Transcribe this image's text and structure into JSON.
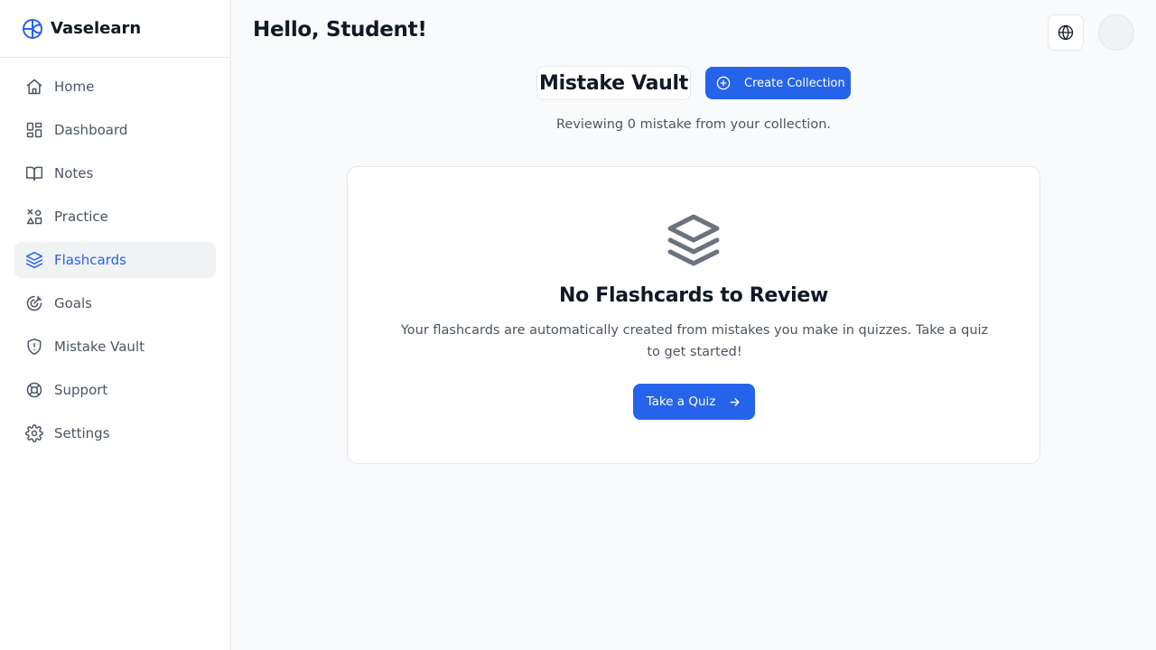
{
  "app": {
    "name": "Vaselearn",
    "logo_icon": "globe-grid-icon"
  },
  "sidebar": {
    "items": [
      {
        "label": "Home",
        "icon": "home-icon",
        "active": false
      },
      {
        "label": "Dashboard",
        "icon": "dashboard-grid-icon",
        "active": false
      },
      {
        "label": "Notes",
        "icon": "book-open-icon",
        "active": false
      },
      {
        "label": "Practice",
        "icon": "shapes-icon",
        "active": false
      },
      {
        "label": "Flashcards",
        "icon": "layers-icon",
        "active": true
      },
      {
        "label": "Goals",
        "icon": "target-icon",
        "active": false
      },
      {
        "label": "Mistake Vault",
        "icon": "shield-alert-icon",
        "active": false
      },
      {
        "label": "Support",
        "icon": "lifebuoy-icon",
        "active": false
      },
      {
        "label": "Settings",
        "icon": "gear-icon",
        "active": false
      }
    ]
  },
  "header": {
    "greeting": "Hello, Student!",
    "language_icon": "globe-icon"
  },
  "main": {
    "title": "Mistake Vault",
    "create_button": "Create Collection",
    "subtitle": "Reviewing 0 mistake from your collection.",
    "empty_state": {
      "icon": "layers-icon",
      "title": "No Flashcards to Review",
      "description": "Your flashcards are automatically created from mistakes you make in quizzes. Take a quiz to get started!",
      "button": "Take a Quiz"
    }
  },
  "colors": {
    "accent": "#2563eb",
    "background": "#f9fafb",
    "active_nav_bg": "#f1f2f4",
    "text_muted": "#4b5563"
  }
}
